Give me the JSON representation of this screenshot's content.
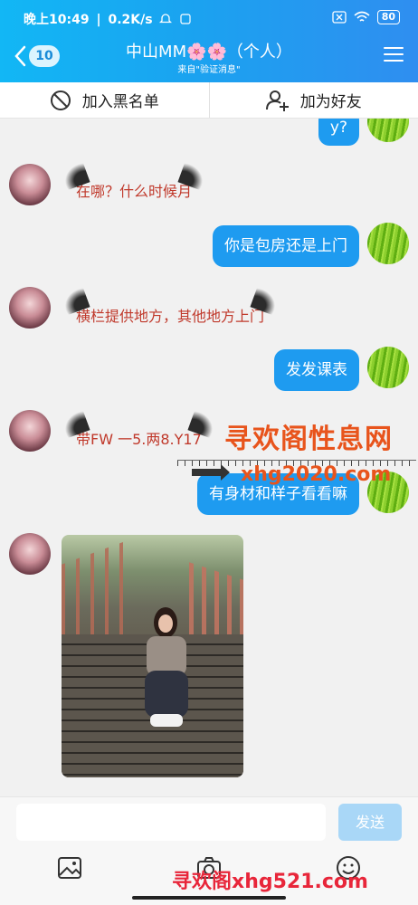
{
  "status_bar": {
    "time": "晚上10:49",
    "separator": "|",
    "net_speed": "0.2K/s",
    "battery": "80"
  },
  "header": {
    "back_badge": "10",
    "title": "中山MM🌸🌸（个人）",
    "subtitle": "来自\"验证消息\""
  },
  "actions": {
    "block_label": "加入黑名单",
    "add_friend_label": "加为好友"
  },
  "messages": [
    {
      "side": "right",
      "text": "y?"
    },
    {
      "side": "left",
      "text": "在哪？什么时候月"
    },
    {
      "side": "right",
      "text": "你是包房还是上门"
    },
    {
      "side": "left",
      "text": "横栏提供地方，其他地方上门"
    },
    {
      "side": "right",
      "text": "发发课表"
    },
    {
      "side": "left",
      "text": "带FW 一5.两8.Y17"
    },
    {
      "side": "right",
      "text": "有身材和样子看看嘛"
    },
    {
      "side": "left",
      "type": "image"
    }
  ],
  "watermarks": {
    "site_name": "寻欢阁性息网",
    "site_url": "xhg2020.com",
    "footer_mark": "寻欢阁xhg521.com"
  },
  "input": {
    "placeholder": "",
    "send_label": "发送"
  },
  "icons": [
    "back-chevron-icon",
    "menu-icon",
    "block-icon",
    "add-friend-icon",
    "picture-icon",
    "camera-icon",
    "emoji-icon"
  ],
  "colors": {
    "accent": "#1e9bf0",
    "header_gradient_start": "#12b7f5",
    "send_disabled": "#a9d7f7",
    "watermark": "#e8541c"
  }
}
